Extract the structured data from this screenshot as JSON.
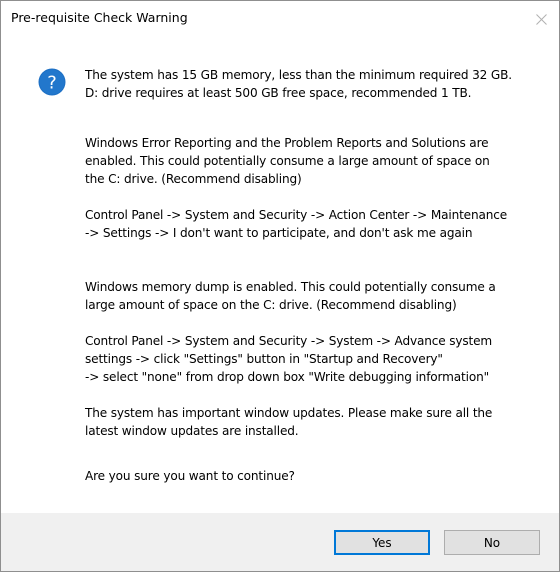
{
  "window": {
    "title": "Pre-requisite Check Warning",
    "close_icon": "close-icon"
  },
  "icon": {
    "name": "question-icon",
    "glyph": "?",
    "color": "#1c6fc4"
  },
  "message": {
    "p1": "The system has 15 GB memory, less than the minimum required 32 GB.\nD: drive requires at least 500 GB free space, recommended 1 TB.",
    "p2": "Windows Error Reporting and the Problem Reports and Solutions are\nenabled.  This could potentially consume a large amount of space on\nthe C: drive.  (Recommend disabling)",
    "p3": "Control Panel -> System and Security -> Action Center -> Maintenance\n-> Settings -> I don't want to participate, and don't ask me again",
    "p4": "Windows memory dump is enabled.  This could potentially consume a\nlarge amount of space on the C: drive. (Recommend disabling)",
    "p5": "Control Panel -> System and Security -> System -> Advance system\nsettings -> click \"Settings\" button in \"Startup and Recovery\"\n-> select \"none\" from drop down box \"Write debugging information\"",
    "p6": "The system has  important window updates.  Please make sure all the\nlatest window updates are installed.",
    "p7": "Are you sure you want to continue?"
  },
  "buttons": {
    "yes": "Yes",
    "no": "No"
  },
  "colors": {
    "accent": "#0078d7",
    "footer_bg": "#f0f0f0",
    "button_bg": "#e1e1e1"
  }
}
